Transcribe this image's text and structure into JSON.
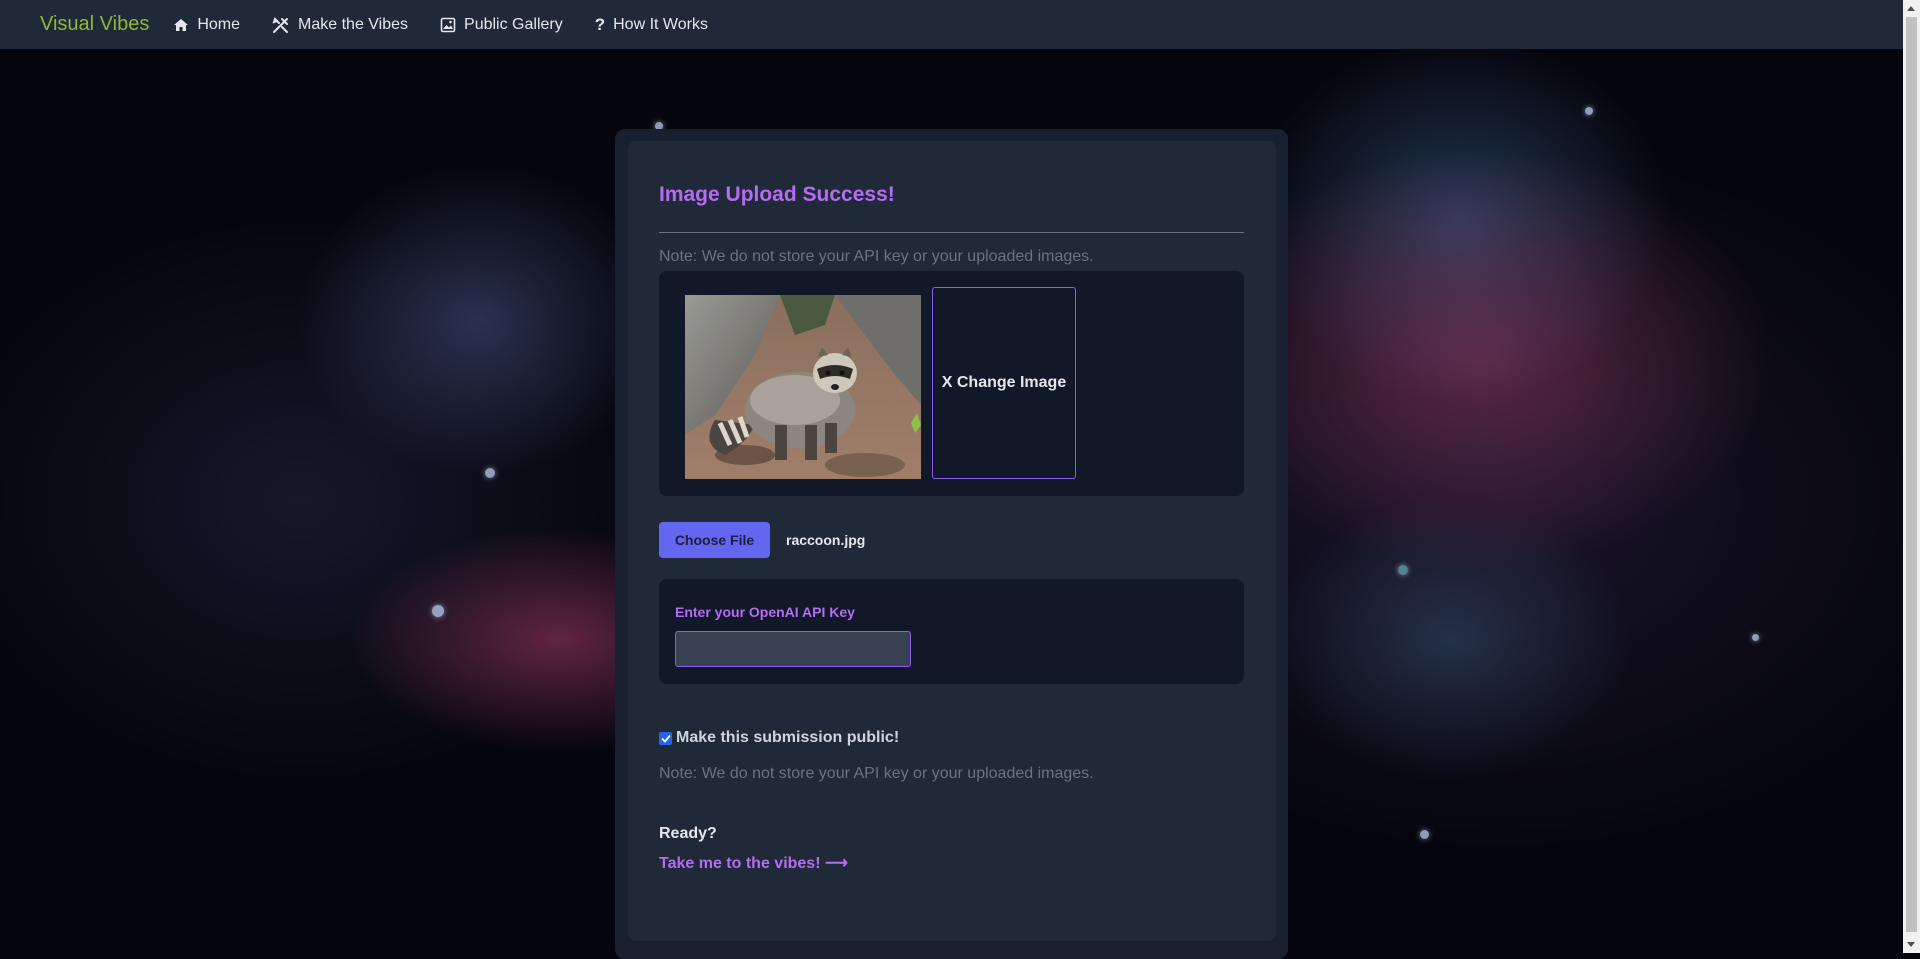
{
  "navbar": {
    "brand": "Visual Vibes",
    "items": [
      {
        "label": "Home",
        "icon": "home-icon"
      },
      {
        "label": "Make the Vibes",
        "icon": "tools-icon"
      },
      {
        "label": "Public Gallery",
        "icon": "image-icon"
      },
      {
        "label": "How It Works",
        "icon": "question-icon"
      }
    ]
  },
  "card": {
    "title": "Image Upload Success!",
    "note_top": "Note: We do not store your API key or your uploaded images.",
    "change_image_label": "X Change Image",
    "choose_file_label": "Choose File",
    "file_name": "raccoon.jpg",
    "api_key_label": "Enter your OpenAI API Key",
    "api_key_value": "",
    "public_checkbox_checked": true,
    "public_label": "Make this submission public!",
    "note_bottom": "Note: We do not store your API key or your uploaded images.",
    "ready_label": "Ready?",
    "vibes_link": "Take me to the vibes! ⟶"
  },
  "colors": {
    "brand": "#8fb73a",
    "accent": "#b56cf2",
    "button": "#6366f1",
    "navbar": "#1f2937"
  }
}
